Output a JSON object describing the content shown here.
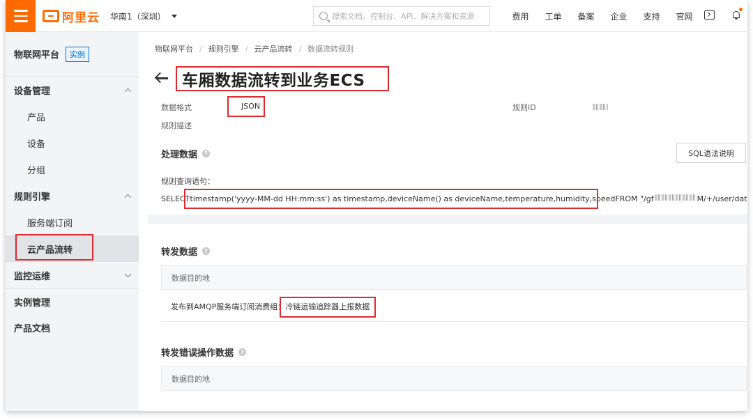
{
  "topbar": {
    "logo_text": "阿里云",
    "region": "华南1（深圳）",
    "search_placeholder": "搜索文档、控制台、API、解决方案和资源",
    "nav": [
      "费用",
      "工单",
      "备案",
      "企业",
      "支持",
      "官网"
    ],
    "accent_color": "#ff6a00"
  },
  "sidebar": {
    "title": "物联网平台",
    "badge": "实例",
    "groups": [
      {
        "label": "设备管理",
        "expanded": true,
        "items": [
          "产品",
          "设备",
          "分组"
        ]
      },
      {
        "label": "规则引擎",
        "expanded": true,
        "items": [
          "服务端订阅",
          "云产品流转"
        ]
      },
      {
        "label": "监控运维",
        "expanded": false,
        "items": []
      }
    ],
    "active_item": "云产品流转",
    "plain_items": [
      "实例管理",
      "产品文档"
    ]
  },
  "breadcrumb": [
    "物联网平台",
    "规则引擎",
    "云产品流转",
    "数据流转规则"
  ],
  "page": {
    "title": "车厢数据流转到业务ECS",
    "data_format_label": "数据格式",
    "data_format_value": "JSON",
    "rule_id_label": "规则ID",
    "rule_desc_label": "规则描述"
  },
  "process": {
    "title": "处理数据",
    "sql_help_button": "SQL语法说明",
    "query_label": "规则查询语句：",
    "sql_select": "SELECT ",
    "sql_fields": "timestamp('yyyy-MM-dd HH:mm:ss') as timestamp,deviceName() as deviceName,temperature,humidity,speed",
    "sql_from": " FROM \"/gf",
    "sql_tail": "M/+/user/data/post"
  },
  "forward": {
    "title": "转发数据",
    "col_header": "数据目的地",
    "row_prefix": "发布到AMQP服务端订阅消费组：",
    "row_target": "冷链运输追踪器上报数据"
  },
  "forward_error": {
    "title": "转发错误操作数据",
    "col_header": "数据目的地"
  },
  "highlight_color": "#e0282e"
}
